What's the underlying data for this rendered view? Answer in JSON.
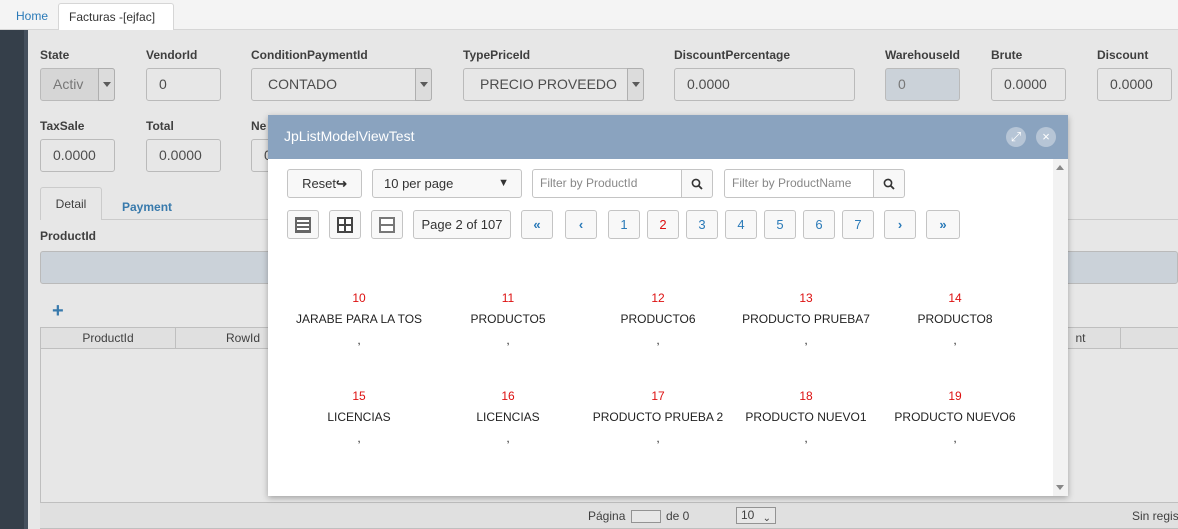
{
  "tabs": {
    "home": "Home",
    "facturas": "Facturas -[ejfac]",
    "close": "×"
  },
  "form": {
    "row1": [
      {
        "label": "State",
        "value": "Activ"
      },
      {
        "label": "VendorId",
        "value": "0"
      },
      {
        "label": "ConditionPaymentId",
        "value": "CONTADO"
      },
      {
        "label": "TypePriceId",
        "value": "PRECIO PROVEEDO"
      },
      {
        "label": "DiscountPercentage",
        "value": "0.0000"
      },
      {
        "label": "WarehouseId",
        "value": "0"
      },
      {
        "label": "Brute",
        "value": "0.0000"
      },
      {
        "label": "Discount",
        "value": "0.0000"
      }
    ],
    "row2": [
      {
        "label": "TaxSale",
        "value": "0.0000"
      },
      {
        "label": "Total",
        "value": "0.0000"
      },
      {
        "label": "Ne",
        "value": "0"
      }
    ],
    "tab_detail": "Detail",
    "tab_payment": "Payment",
    "product_label": "ProductId",
    "add": "+",
    "grid_cols": [
      "ProductId",
      "RowId",
      "nt"
    ],
    "pager": {
      "pagina": "Página",
      "de": "de 0",
      "size": "10",
      "sin": "Sin regis"
    }
  },
  "modal": {
    "title": "JpListModelViewTest",
    "reset": "Reset",
    "per_page": "10 per page",
    "filter_id_placeholder": "Filter by ProductId",
    "filter_name_placeholder": "Filter by ProductName",
    "page_info": "Page 2 of 107",
    "pages": [
      "1",
      "2",
      "3",
      "4",
      "5",
      "6",
      "7"
    ],
    "active_page": "2",
    "nav": {
      "first": "«",
      "prev": "‹",
      "next": "›",
      "last": "»"
    },
    "items": [
      {
        "id": "10",
        "name": "JARABE PARA LA TOS",
        "extra": ","
      },
      {
        "id": "11",
        "name": "PRODUCTO5",
        "extra": ","
      },
      {
        "id": "12",
        "name": "PRODUCTO6",
        "extra": ","
      },
      {
        "id": "13",
        "name": "PRODUCTO PRUEBA7",
        "extra": ","
      },
      {
        "id": "14",
        "name": "PRODUCTO8",
        "extra": ","
      },
      {
        "id": "15",
        "name": "LICENCIAS",
        "extra": ","
      },
      {
        "id": "16",
        "name": "LICENCIAS",
        "extra": ","
      },
      {
        "id": "17",
        "name": "PRODUCTO PRUEBA 2",
        "extra": ","
      },
      {
        "id": "18",
        "name": "PRODUCTO NUEVO1",
        "extra": ","
      },
      {
        "id": "19",
        "name": "PRODUCTO NUEVO6",
        "extra": ","
      }
    ]
  },
  "colors": {
    "accent": "#2a7ab8",
    "modal_header": "#8aa3bf",
    "id_red": "#dd1111"
  }
}
